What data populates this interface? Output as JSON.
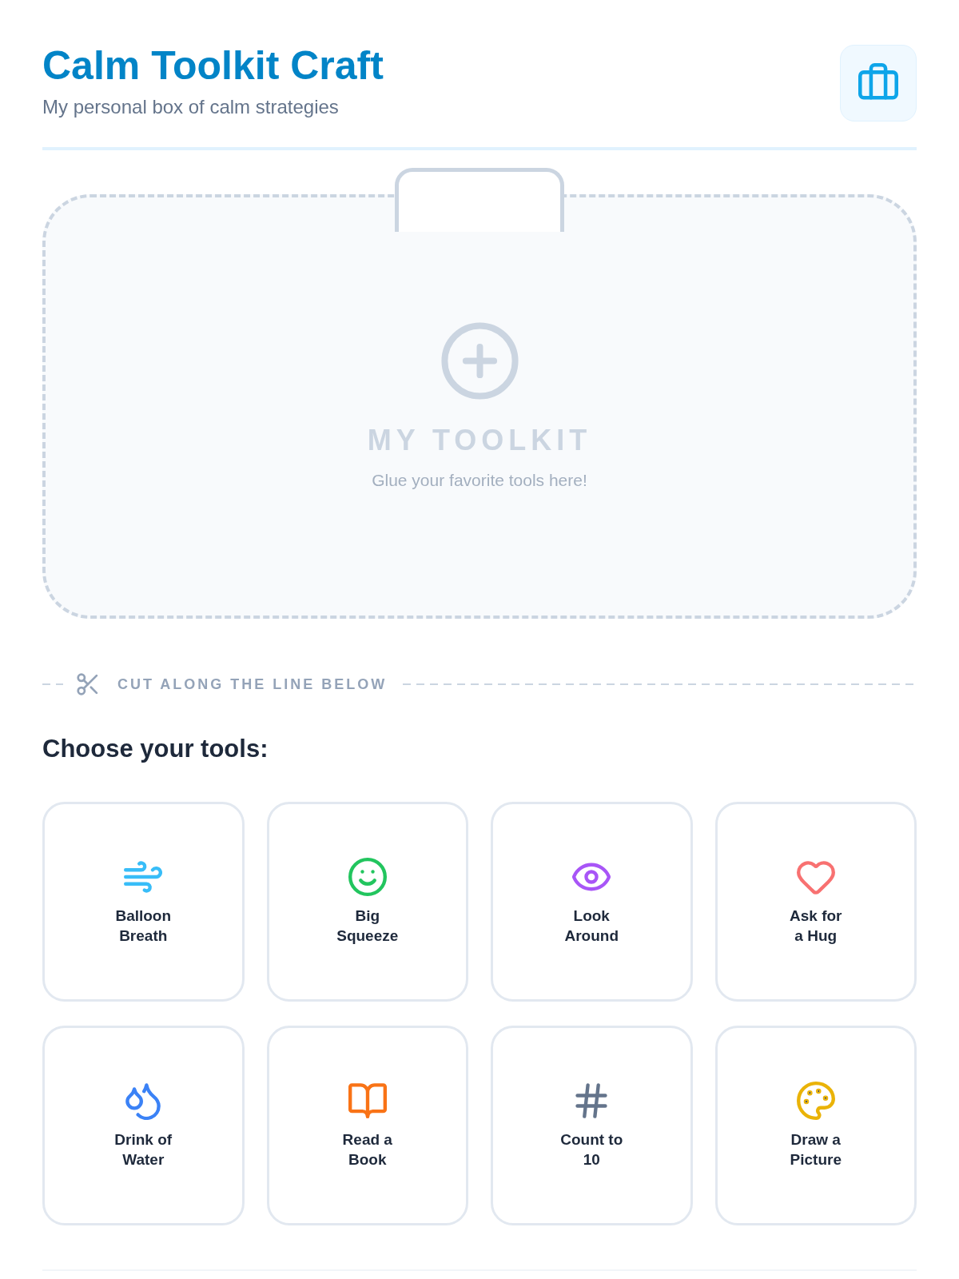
{
  "header": {
    "title": "Calm Toolkit Craft",
    "subtitle": "My personal box of calm strategies"
  },
  "toolkit": {
    "title": "MY TOOLKIT",
    "hint": "Glue your favorite tools here!"
  },
  "cut_line": {
    "label": "CUT ALONG THE LINE BELOW"
  },
  "tools_heading": "Choose your tools:",
  "tools": [
    {
      "label": "Balloon\nBreath",
      "color": "#38bdf8"
    },
    {
      "label": "Big\nSqueeze",
      "color": "#22c55e"
    },
    {
      "label": "Look\nAround",
      "color": "#a855f7"
    },
    {
      "label": "Ask for\na Hug",
      "color": "#f87171"
    },
    {
      "label": "Drink of\nWater",
      "color": "#3b82f6"
    },
    {
      "label": "Read a\nBook",
      "color": "#f97316"
    },
    {
      "label": "Count to\n10",
      "color": "#64748b"
    },
    {
      "label": "Draw a\nPicture",
      "color": "#eab308"
    }
  ]
}
